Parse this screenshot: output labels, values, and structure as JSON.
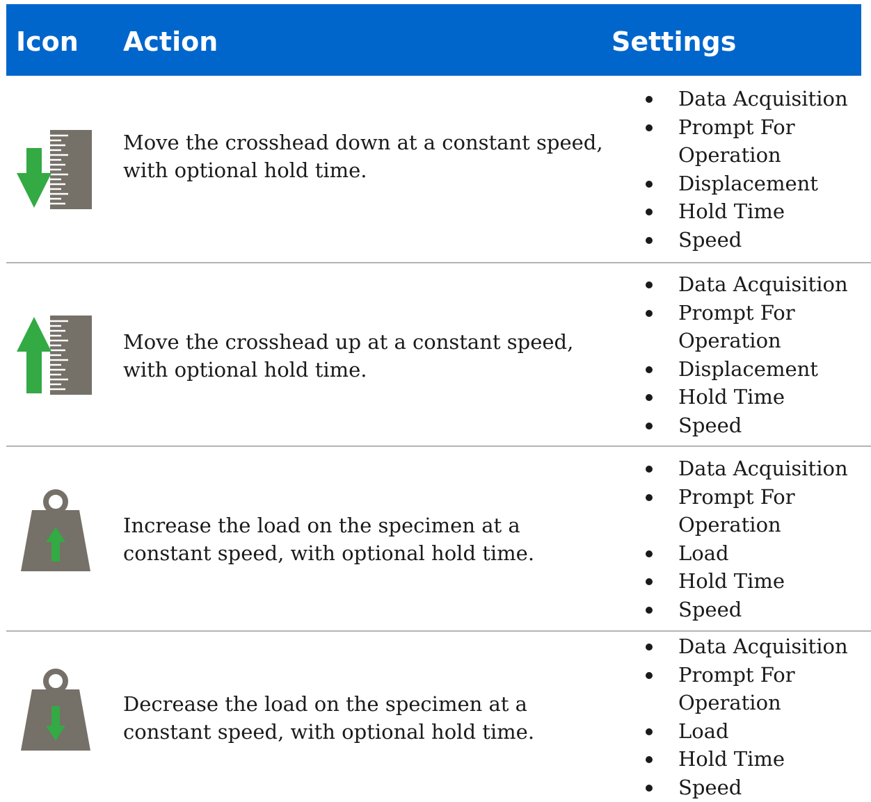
{
  "header": {
    "icon": "Icon",
    "action": "Action",
    "settings": "Settings"
  },
  "colors": {
    "header_bg": "#0066cc",
    "header_text": "#ffffff",
    "arrow_green": "#33aa44",
    "icon_gray": "#757068",
    "separator": "#b3b3b3"
  },
  "rows": [
    {
      "icon": "crosshead-down-icon",
      "action": "Move the crosshead down at a constant speed, with optional hold time.",
      "settings": [
        "Data Acquisition",
        "Prompt For Operation",
        "Displacement",
        "Hold Time",
        "Speed"
      ]
    },
    {
      "icon": "crosshead-up-icon",
      "action": "Move the crosshead up at a constant speed, with optional hold time.",
      "settings": [
        "Data Acquisition",
        "Prompt For Operation",
        "Displacement",
        "Hold Time",
        "Speed"
      ]
    },
    {
      "icon": "load-increase-icon",
      "action": "Increase the load on the specimen at a constant speed, with optional hold time.",
      "settings": [
        "Data Acquisition",
        "Prompt For Operation",
        "Load",
        "Hold Time",
        "Speed"
      ]
    },
    {
      "icon": "load-decrease-icon",
      "action": "Decrease the load on the specimen at a constant speed, with optional hold time.",
      "settings": [
        "Data Acquisition",
        "Prompt For Operation",
        "Load",
        "Hold Time",
        "Speed"
      ]
    }
  ]
}
